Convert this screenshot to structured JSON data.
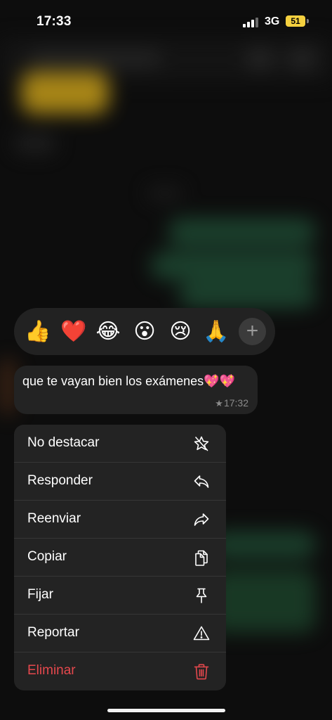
{
  "status_bar": {
    "time": "17:33",
    "network": "3G",
    "battery": "51",
    "battery_color": "#f4d03f"
  },
  "reactions": {
    "items": [
      {
        "emoji": "👍",
        "icon": "thumbs-up-icon"
      },
      {
        "emoji": "❤️",
        "icon": "red-heart-icon"
      },
      {
        "emoji": "😂",
        "icon": "tears-of-joy-icon"
      },
      {
        "emoji": "😮",
        "icon": "surprised-face-icon"
      },
      {
        "emoji": "😢",
        "icon": "crying-face-icon"
      },
      {
        "emoji": "🙏",
        "icon": "folded-hands-icon"
      }
    ],
    "add_label": "+"
  },
  "message": {
    "text": "que te vayan bien los exámenes💖💖",
    "time": "17:32",
    "starred_icon": "star-icon"
  },
  "menu": {
    "items": [
      {
        "label": "No destacar",
        "icon": "unstar-icon"
      },
      {
        "label": "Responder",
        "icon": "reply-icon"
      },
      {
        "label": "Reenviar",
        "icon": "forward-icon"
      },
      {
        "label": "Copiar",
        "icon": "copy-icon"
      },
      {
        "label": "Fijar",
        "icon": "pin-icon"
      },
      {
        "label": "Reportar",
        "icon": "warning-icon"
      },
      {
        "label": "Eliminar",
        "icon": "trash-icon",
        "color": "#e5484d"
      }
    ]
  }
}
